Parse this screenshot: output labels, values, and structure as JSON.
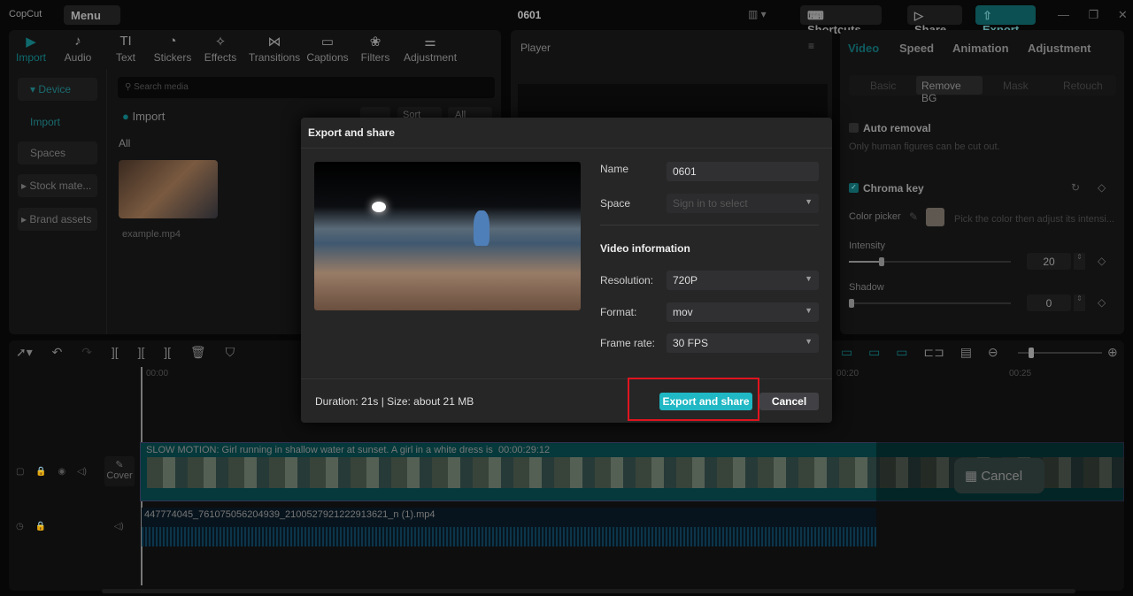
{
  "app": {
    "logo": "CopCut",
    "menu": "Menu",
    "project_title": "0601",
    "shortcuts": "Shortcuts",
    "share": "Share",
    "export": "Export"
  },
  "media_tabs": [
    {
      "label": "Import",
      "icon": "▶"
    },
    {
      "label": "Audio",
      "icon": "♪"
    },
    {
      "label": "Text",
      "icon": "TI"
    },
    {
      "label": "Stickers",
      "icon": "◔"
    },
    {
      "label": "Effects",
      "icon": "✧"
    },
    {
      "label": "Transitions",
      "icon": "⋈"
    },
    {
      "label": "Captions",
      "icon": "▭"
    },
    {
      "label": "Filters",
      "icon": "❀"
    },
    {
      "label": "Adjustment",
      "icon": "⚌"
    }
  ],
  "sidebar": {
    "device": "▾ Device",
    "import": "Import",
    "spaces": "Spaces",
    "stock": "▸ Stock mate...",
    "brand": "▸ Brand assets"
  },
  "media": {
    "search_placeholder": "Search media",
    "import": "Import",
    "sort": "Sort",
    "all_filter": "All",
    "all": "All",
    "clip_name": "example.mp4"
  },
  "player": {
    "title": "Player"
  },
  "right": {
    "tabs": [
      "Video",
      "Speed",
      "Animation",
      "Adjustment"
    ],
    "subtabs": [
      "Basic",
      "Remove BG",
      "Mask",
      "Retouch"
    ],
    "auto_removal": "Auto removal",
    "auto_hint": "Only human figures can be cut out.",
    "chroma_key": "Chroma key",
    "color_picker": "Color picker",
    "picker_hint": "Pick the color then adjust its intensi...",
    "intensity_label": "Intensity",
    "intensity": "20",
    "intensity_level": 0.2,
    "shadow_label": "Shadow",
    "shadow": "0",
    "shadow_level": 0
  },
  "timeline": {
    "t0": "00:00",
    "t20": "00:20",
    "t25": "00:25",
    "video_caption": "SLOW MOTION: Girl running in shallow water at sunset. A girl in a white dress is",
    "video_duration": "00:00:29:12",
    "cover": "Cover",
    "audio_name": "447774045_761075056204939_2100527921222913621_n (1).mp4",
    "cancel": "Cancel"
  },
  "dialog": {
    "title": "Export and share",
    "name_label": "Name",
    "name_value": "0601",
    "space_label": "Space",
    "space_placeholder": "Sign in to select",
    "video_info": "Video information",
    "resolution_label": "Resolution:",
    "resolution": "720P",
    "format_label": "Format:",
    "format": "mov",
    "framerate_label": "Frame rate:",
    "framerate": "30 FPS",
    "summary": "Duration: 21s | Size: about 21 MB",
    "export_btn": "Export and share",
    "cancel_btn": "Cancel"
  },
  "colors": {
    "accent": "#1fb8c4",
    "highlight": "#e0141e"
  }
}
